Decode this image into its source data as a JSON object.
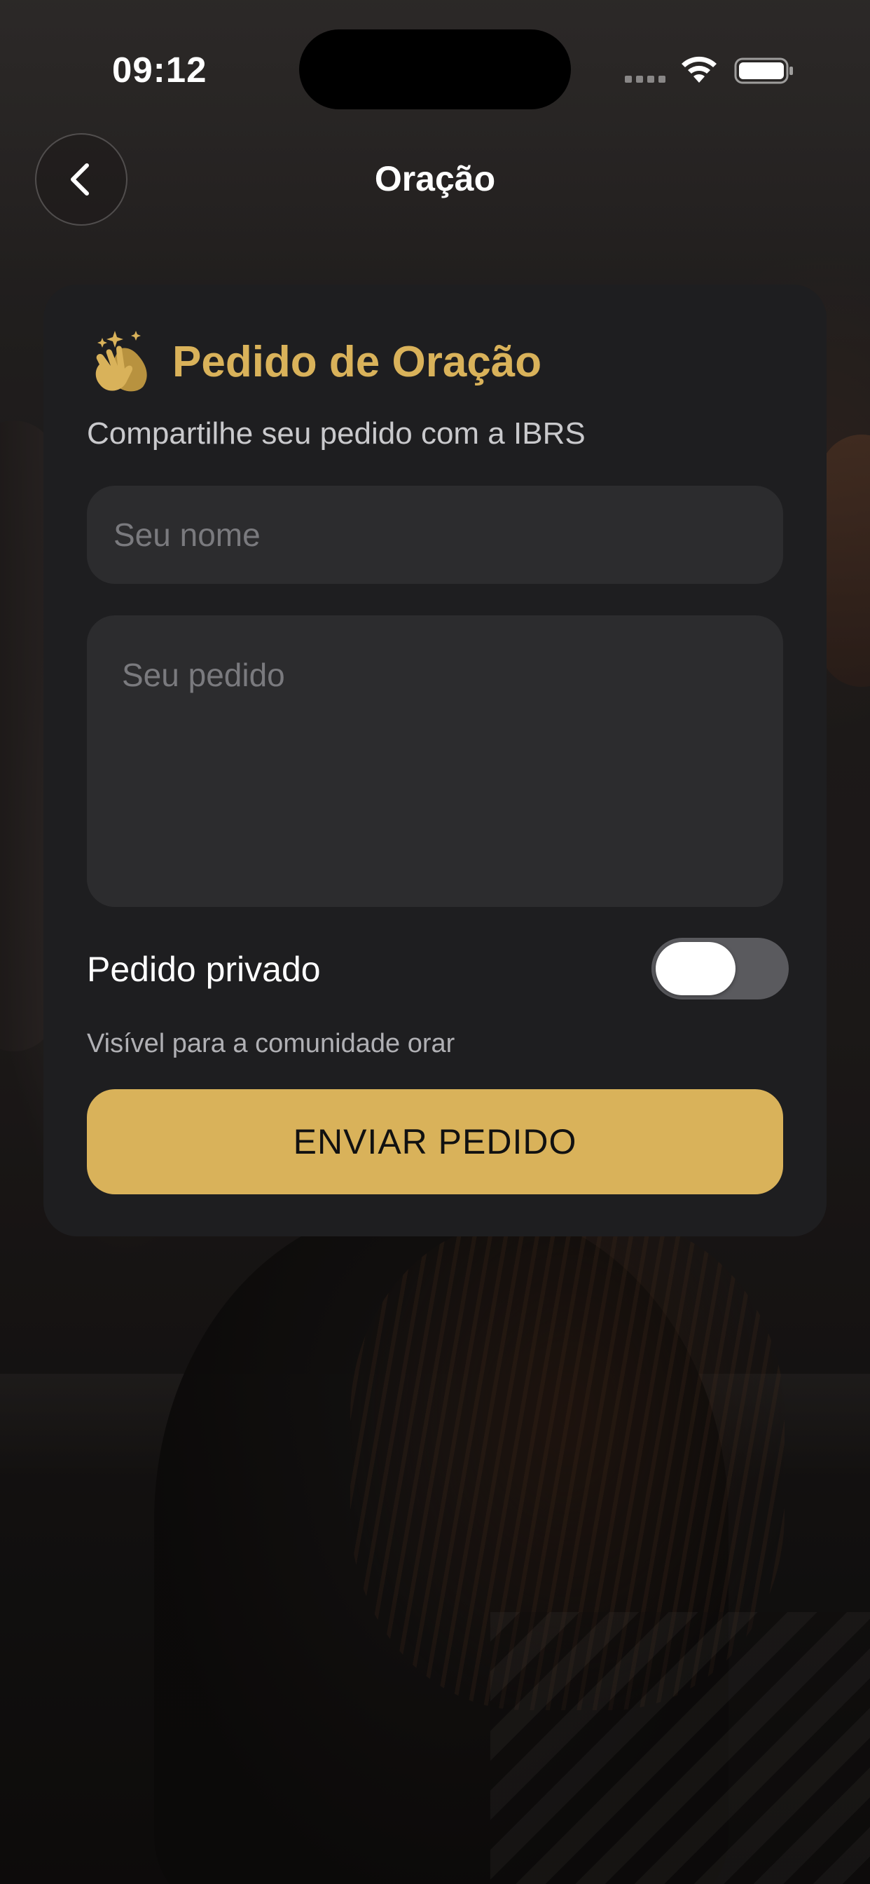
{
  "status_bar": {
    "time": "09:12"
  },
  "nav": {
    "back_icon": "chevron-left-icon",
    "title": "Oração"
  },
  "card": {
    "icon": "clapping-hands-icon",
    "title": "Pedido de Oração",
    "subtitle": "Compartilhe seu pedido com a IBRS",
    "name_field": {
      "placeholder": "Seu nome",
      "value": ""
    },
    "request_field": {
      "placeholder": "Seu pedido",
      "value": ""
    },
    "private_toggle": {
      "label": "Pedido privado",
      "on": false,
      "hint": "Visível para a comunidade orar"
    },
    "submit_label": "ENVIAR PEDIDO"
  },
  "colors": {
    "accent": "#d9b25a",
    "card_bg": "#1e1e20",
    "field_bg": "#2c2c2e"
  }
}
